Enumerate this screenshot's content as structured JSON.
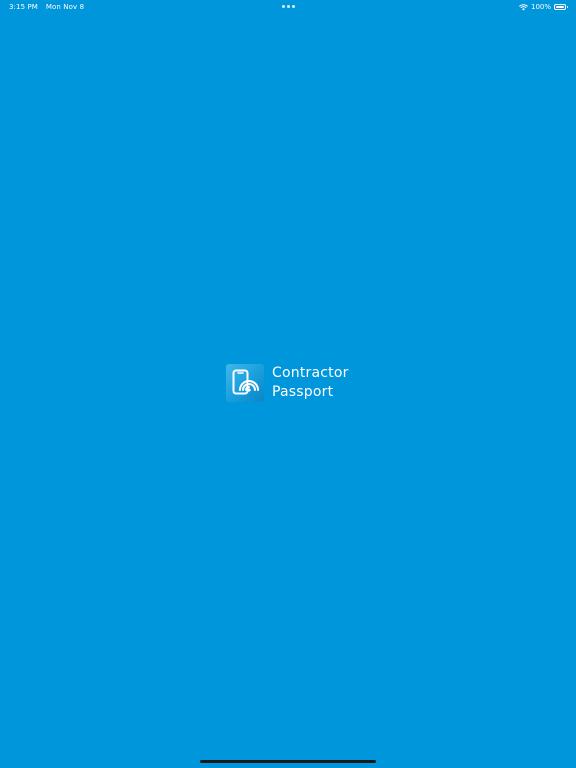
{
  "status_bar": {
    "time": "3:15 PM",
    "date": "Mon Nov 8",
    "battery_percent": "100%",
    "battery_level": 1.0,
    "wifi_icon": "wifi-icon",
    "battery_icon": "battery-icon"
  },
  "splash": {
    "app_name_line1": "Contractor",
    "app_name_line2": "Passport",
    "icon": "phone-nfc-icon"
  },
  "colors": {
    "background": "#0096DC",
    "text": "#FFFFFF",
    "home_indicator": "#1A1A1A"
  }
}
